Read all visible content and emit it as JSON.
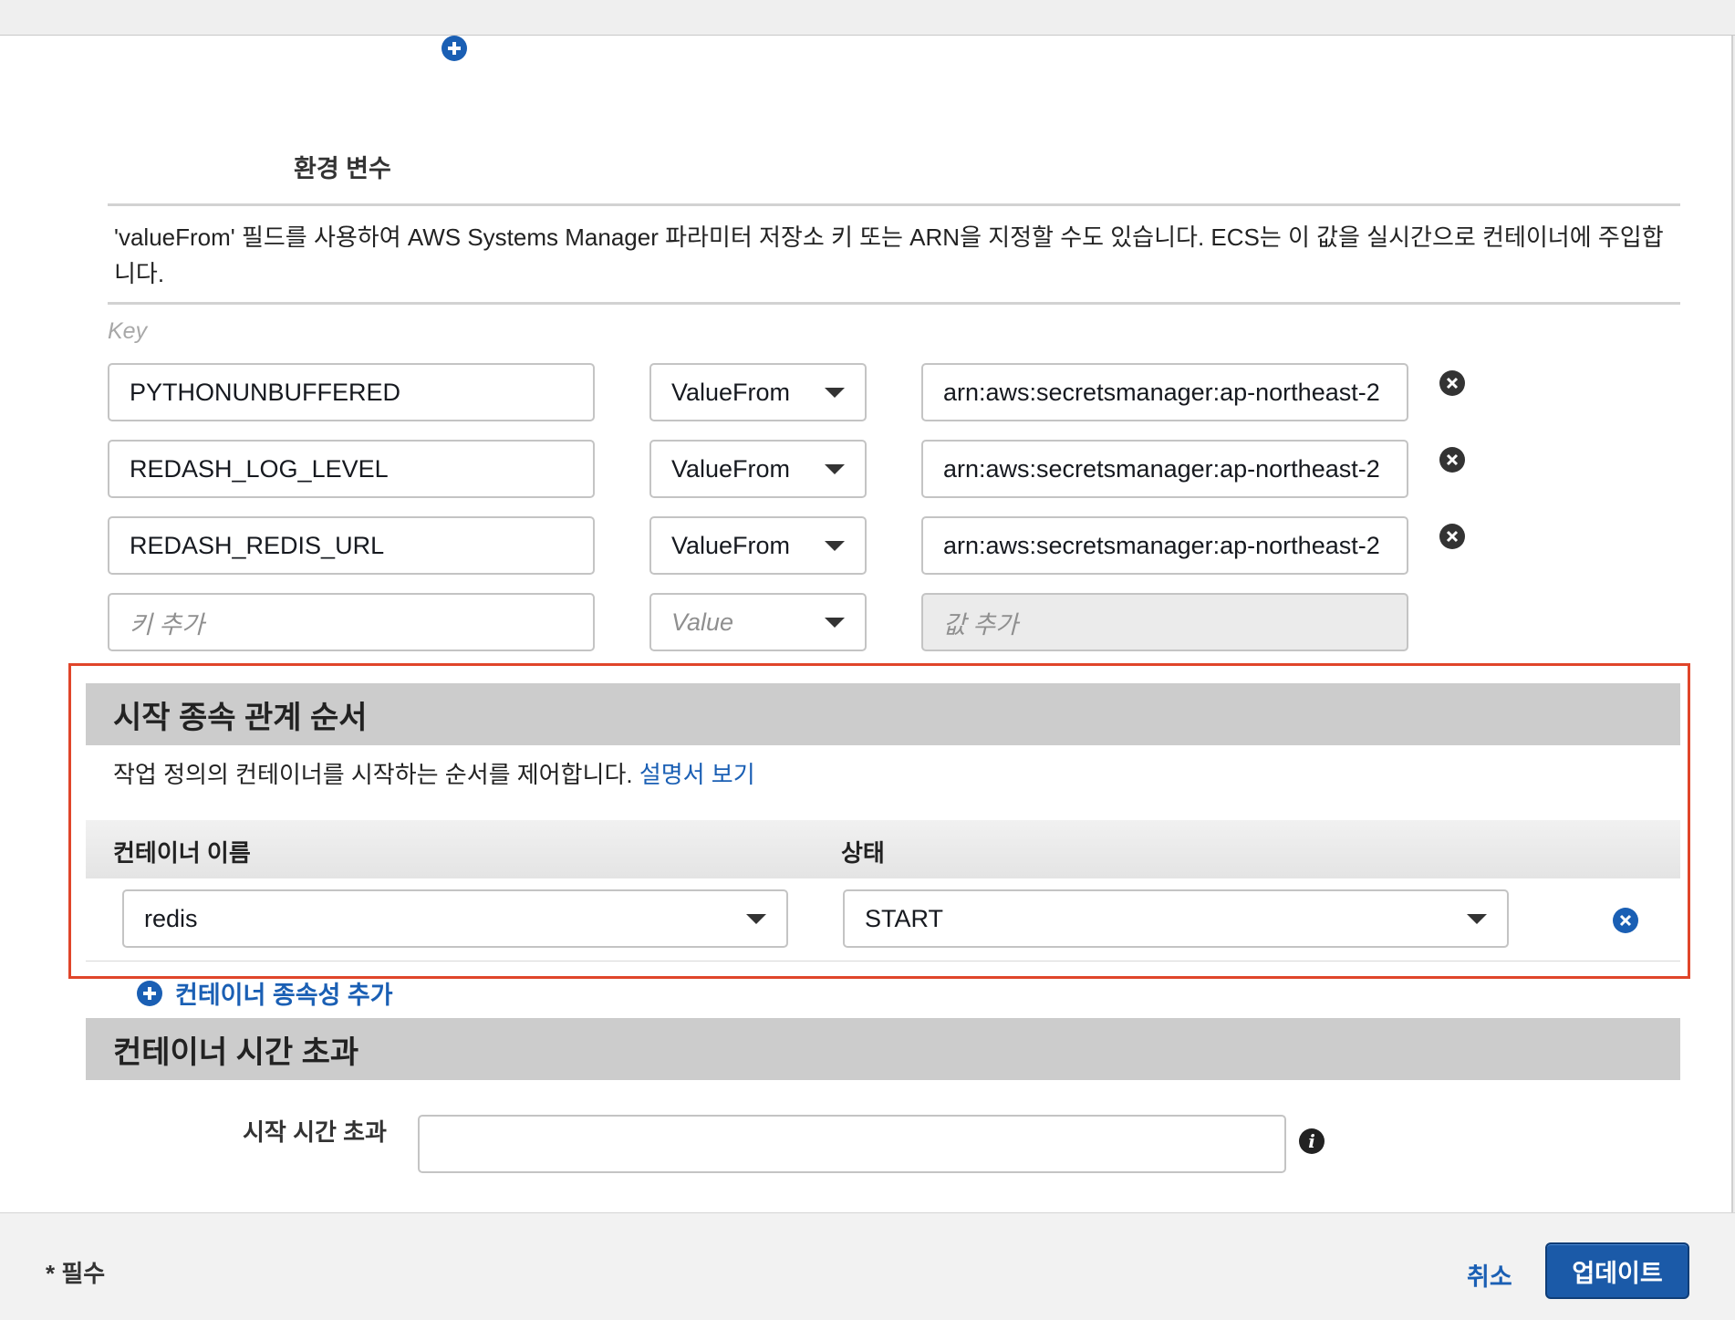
{
  "env": {
    "title": "환경 변수",
    "description": "'valueFrom' 필드를 사용하여 AWS Systems Manager 파라미터 저장소 키 또는 ARN을 지정할 수도 있습니다. ECS는 이 값을 실시간으로 컨테이너에 주입합니다.",
    "key_header": "Key",
    "rows": [
      {
        "key": "PYTHONUNBUFFERED",
        "type": "ValueFrom",
        "value": "arn:aws:secretsmanager:ap-northeast-2"
      },
      {
        "key": "REDASH_LOG_LEVEL",
        "type": "ValueFrom",
        "value": "arn:aws:secretsmanager:ap-northeast-2"
      },
      {
        "key": "REDASH_REDIS_URL",
        "type": "ValueFrom",
        "value": "arn:aws:secretsmanager:ap-northeast-2"
      }
    ],
    "new_row": {
      "key_placeholder": "키 추가",
      "type_placeholder": "Value",
      "value_placeholder": "값 추가"
    }
  },
  "dependency": {
    "title": "시작 종속 관계 순서",
    "description": "작업 정의의 컨테이너를 시작하는 순서를 제어합니다.",
    "doc_link": "설명서 보기",
    "col_container": "컨테이너 이름",
    "col_condition": "상태",
    "rows": [
      {
        "container": "redis",
        "condition": "START"
      }
    ],
    "add_label": "컨테이너 종속성 추가",
    "highlight_color": "#e0452a"
  },
  "timeout": {
    "title": "컨테이너 시간 초과",
    "start_label": "시작 시간 초과",
    "start_value": ""
  },
  "footer": {
    "required_note": "* 필수",
    "cancel": "취소",
    "update": "업데이트"
  },
  "colors": {
    "accent": "#1a5fb4",
    "band": "#cccccc",
    "primary_button": "#1b5aa8"
  }
}
